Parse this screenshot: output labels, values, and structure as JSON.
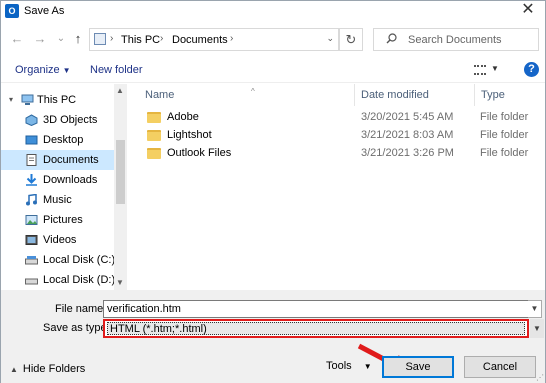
{
  "window": {
    "title": "Save As",
    "app_icon": "outlook-icon",
    "close_glyph": "✕"
  },
  "nav": {
    "back_glyph": "←",
    "forward_glyph": "→",
    "recent_glyph": "⌄",
    "up_glyph": "↑",
    "breadcrumb": [
      "This PC",
      "Documents"
    ],
    "search_placeholder": "Search Documents"
  },
  "toolbar": {
    "organize_label": "Organize",
    "new_folder_label": "New folder",
    "help_glyph": "?"
  },
  "sidebar": {
    "items": [
      {
        "label": "This PC",
        "icon": "computer-icon"
      },
      {
        "label": "3D Objects",
        "icon": "cube-icon"
      },
      {
        "label": "Desktop",
        "icon": "desktop-icon"
      },
      {
        "label": "Documents",
        "icon": "document-icon",
        "selected": true
      },
      {
        "label": "Downloads",
        "icon": "download-icon"
      },
      {
        "label": "Music",
        "icon": "music-icon"
      },
      {
        "label": "Pictures",
        "icon": "pictures-icon"
      },
      {
        "label": "Videos",
        "icon": "video-icon"
      },
      {
        "label": "Local Disk (C:)",
        "icon": "drive-icon"
      },
      {
        "label": "Local Disk (D:)",
        "icon": "drive-icon"
      }
    ]
  },
  "files": {
    "columns": {
      "name": "Name",
      "date": "Date modified",
      "type": "Type"
    },
    "rows": [
      {
        "name": "Adobe",
        "date": "3/20/2021 5:45 AM",
        "type": "File folder"
      },
      {
        "name": "Lightshot",
        "date": "3/21/2021 8:03 AM",
        "type": "File folder"
      },
      {
        "name": "Outlook Files",
        "date": "3/21/2021 3:26 PM",
        "type": "File folder"
      }
    ]
  },
  "form": {
    "file_name_label": "File name:",
    "file_name_value": "verification.htm",
    "save_as_type_label": "Save as type:",
    "save_as_type_value": "HTML (*.htm;*.html)",
    "hide_folders_label": "Hide Folders",
    "tools_label": "Tools",
    "save_label": "Save",
    "cancel_label": "Cancel"
  },
  "colors": {
    "highlight_red": "#e01b1b",
    "selection": "#cce8ff",
    "accent": "#0078d7"
  }
}
